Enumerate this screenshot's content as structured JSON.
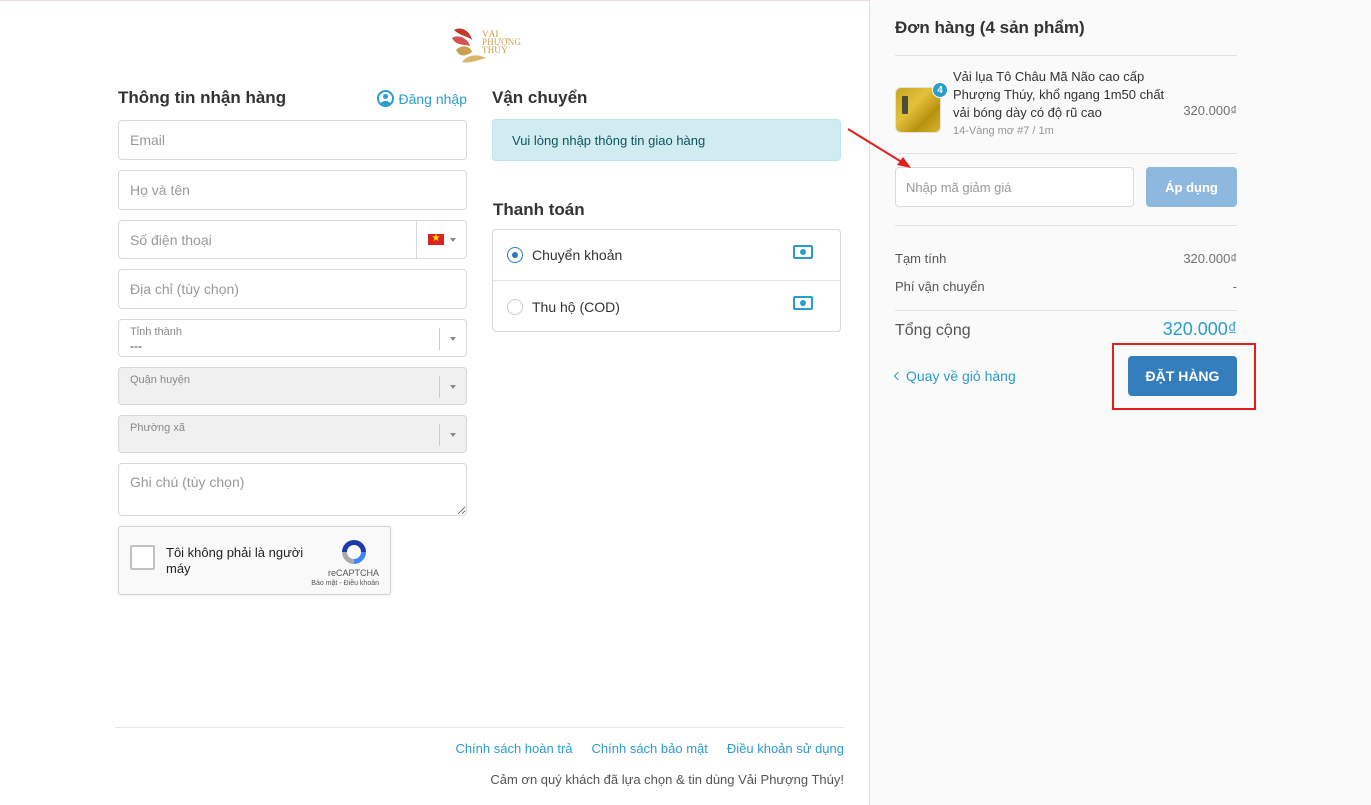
{
  "brand": {
    "logo_line1": "Vải",
    "logo_line2": "Phượng",
    "logo_line3": "Thủy"
  },
  "shipping_info": {
    "title": "Thông tin nhận hàng",
    "login_label": "Đăng nhập",
    "email_placeholder": "Email",
    "name_placeholder": "Họ và tên",
    "phone_placeholder": "Số điện thoại",
    "address_placeholder": "Địa chỉ (tùy chọn)",
    "province_label": "Tỉnh thành",
    "province_value": "---",
    "district_label": "Quận huyện",
    "ward_label": "Phường xã",
    "note_placeholder": "Ghi chú (tùy chọn)"
  },
  "recaptcha": {
    "label": "Tôi không phải là người máy",
    "brand": "reCAPTCHA",
    "terms": "Bảo mật - Điều khoản"
  },
  "shipping": {
    "title": "Vận chuyển",
    "notice": "Vui lòng nhập thông tin giao hàng"
  },
  "payment": {
    "title": "Thanh toán",
    "options": [
      {
        "label": "Chuyển khoản",
        "selected": true
      },
      {
        "label": "Thu hộ (COD)",
        "selected": false
      }
    ]
  },
  "footer": {
    "links": [
      "Chính sách hoàn trả",
      "Chính sách bảo mật",
      "Điều khoản sử dụng"
    ],
    "thanks": "Cảm ơn quý khách đã lựa chọn & tin dùng Vải Phượng Thúy!"
  },
  "order": {
    "title": "Đơn hàng (4 sản phẩm)",
    "item": {
      "name": "Vải lụa Tô Châu Mã Não cao cấp Phượng Thúy, khổ ngang 1m50 chất vải bóng dày có độ rũ cao",
      "variant": "14-Vàng mơ #7 / 1m",
      "quantity": "4",
      "price": "320.000₫"
    },
    "coupon_placeholder": "Nhập mã giảm giá",
    "apply_label": "Áp dụng",
    "subtotal_label": "Tạm tính",
    "subtotal_value": "320.000₫",
    "shipping_fee_label": "Phí vận chuyển",
    "shipping_fee_value": "-",
    "total_label": "Tổng cộng",
    "total_value": "320.000₫",
    "back_label": "Quay về giỏ hàng",
    "place_order_label": "ĐẶT HÀNG"
  },
  "colors": {
    "accent": "#2a9dcc",
    "primary_button": "#357ebd",
    "annotation": "#e31d1d"
  }
}
